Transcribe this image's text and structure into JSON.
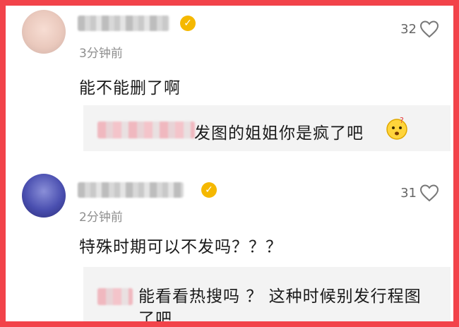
{
  "comments": [
    {
      "time": "3分钟前",
      "likes": "32",
      "text": "能不能删了啊",
      "reply_text": "发图的姐姐你是疯了吧",
      "verified_icon": "check",
      "emoji": "confused-face-icon"
    },
    {
      "time": "2分钟前",
      "likes": "31",
      "text": "特殊时期可以不发吗？？？",
      "reply_text": "能看看热搜吗 ？ 这种时候别发行程图了吧",
      "verified_icon": "check"
    }
  ],
  "colors": {
    "frame": "#f2434a",
    "verified": "#f5b800",
    "reply_bg": "#f3f3f3",
    "muted_text": "#8e8e8e"
  }
}
